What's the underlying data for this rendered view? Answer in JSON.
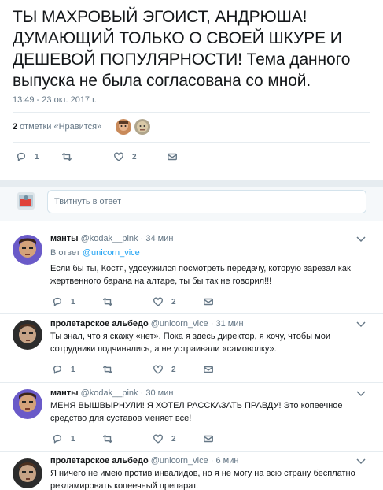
{
  "tweet": {
    "text": "ТЫ МАХРОВЫЙ ЭГОИСТ, АНДРЮША! ДУМАЮЩИЙ ТОЛЬКО О СВОЕЙ ШКУРЕ И ДЕШЕВОЙ ПОПУЛЯРНОСТИ! Тема данного выпуска не была согласована со мной.",
    "timestamp": "13:49 - 23 окт. 2017 г.",
    "likes_count": "2",
    "likes_label": " отметки «Нравится»",
    "actions": {
      "reply_count": "1",
      "retweet_count": "",
      "like_count": "2"
    },
    "icons": [
      "reply-icon",
      "retweet-icon",
      "heart-icon",
      "mail-icon"
    ]
  },
  "reply_box": {
    "placeholder": "Твитнуть в ответ"
  },
  "replies": [
    {
      "name": "манты",
      "handle": "@kodak__pink",
      "time": "· 34 мин",
      "in_reply_prefix": "В ответ ",
      "in_reply_to": "@unicorn_vice",
      "text": "Если бы ты, Костя, удосужился посмотреть передачу, которую зарезал как жертвенного барана на алтаре, ты бы так не говорил!!!",
      "reply_count": "1",
      "like_count": "2"
    },
    {
      "name": "пролетарское альбедо",
      "handle": "@unicorn_vice",
      "time": "· 31 мин",
      "text": "Ты знал, что я скажу «нет». Пока я здесь директор, я хочу, чтобы мои сотрудники подчинялись, а не устраивали «самоволку».",
      "reply_count": "1",
      "like_count": "2"
    },
    {
      "name": "манты",
      "handle": "@kodak__pink",
      "time": "· 30 мин",
      "text": "МЕНЯ ВЫШВЫРНУЛИ! Я ХОТЕЛ РАССКАЗАТЬ ПРАВДУ! Это копеечное средство для суставов меняет все!",
      "reply_count": "1",
      "like_count": "2"
    },
    {
      "name": "пролетарское альбедо",
      "handle": "@unicorn_vice",
      "time": "· 6 мин",
      "text": "Я ничего не имею против инвалидов, но я не могу на всю страну бесплатно рекламировать копеечный препарат."
    }
  ],
  "colors": {
    "link": "#1da1f2",
    "muted": "#657786",
    "border": "#e6ecf0",
    "band": "#e6ecf0"
  }
}
